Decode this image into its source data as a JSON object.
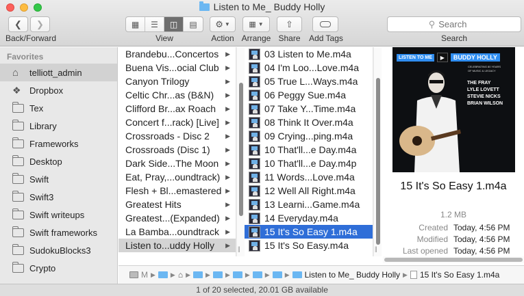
{
  "window": {
    "title": "Listen to Me_ Buddy Holly"
  },
  "toolbar": {
    "back_forward_label": "Back/Forward",
    "view_label": "View",
    "action_label": "Action",
    "arrange_label": "Arrange",
    "share_label": "Share",
    "add_tags_label": "Add Tags",
    "search_label": "Search",
    "search_placeholder": "Search",
    "active_view": "columns"
  },
  "sidebar": {
    "header": "Favorites",
    "items": [
      {
        "label": "telliott_admin",
        "icon": "home-icon",
        "selected": true
      },
      {
        "label": "Dropbox",
        "icon": "dropbox-icon"
      },
      {
        "label": "Tex",
        "icon": "folder-icon"
      },
      {
        "label": "Library",
        "icon": "folder-icon"
      },
      {
        "label": "Frameworks",
        "icon": "folder-icon"
      },
      {
        "label": "Desktop",
        "icon": "folder-icon"
      },
      {
        "label": "Swift",
        "icon": "folder-icon"
      },
      {
        "label": "Swift3",
        "icon": "folder-icon"
      },
      {
        "label": "Swift writeups",
        "icon": "folder-icon"
      },
      {
        "label": "Swift frameworks",
        "icon": "folder-icon"
      },
      {
        "label": "SudokuBlocks3",
        "icon": "folder-icon"
      },
      {
        "label": "Crypto",
        "icon": "folder-icon"
      }
    ]
  },
  "albums_column": {
    "items": [
      "Brandebu...Concertos",
      "Buena Vis...ocial Club",
      "Canyon Trilogy",
      "Celtic Chr...as (B&N)",
      "Clifford Br...ax Roach",
      "Concert f...rack) [Live]",
      "Crossroads - Disc 2",
      "Crossroads (Disc 1)",
      "Dark Side...The Moon",
      "Eat, Pray,...oundtrack)",
      "Flesh + Bl...emastered",
      "Greatest Hits",
      "Greatest...(Expanded)",
      "La Bamba...oundtrack",
      "Listen to...uddy Holly"
    ],
    "selected": "Listen to...uddy Holly"
  },
  "tracks_column": {
    "items": [
      "03 Listen to Me.m4a",
      "04 I'm Loo...Love.m4a",
      "05 True L...Ways.m4a",
      "06 Peggy Sue.m4a",
      "07 Take Y...Time.m4a",
      "08 Think It Over.m4a",
      "09 Crying...ping.m4a",
      "10 That'll...e Day.m4a",
      "10 That'll...e Day.m4p",
      "11 Words...Love.m4a",
      "12 Well All Right.m4a",
      "13 Learni...Game.m4a",
      "14 Everyday.m4a",
      "15 It's So Easy 1.m4a",
      "15 It's So Easy.m4a"
    ],
    "selected": "15 It's So Easy 1.m4a"
  },
  "preview": {
    "art": {
      "listen_to_me": "LISTEN TO ME",
      "artist": "BUDDY HOLLY",
      "subtitle_1": "CELEBRATING 80 YEARS",
      "subtitle_2": "OF MUSIC & LEGACY",
      "names": [
        "THE FRAY",
        "LYLE LOVETT",
        "STEVIE NICKS",
        "BRIAN WILSON"
      ]
    },
    "file_name": "15 It's So Easy 1.m4a",
    "size": "1.2 MB",
    "created_label": "Created",
    "created": "Today, 4:56 PM",
    "modified_label": "Modified",
    "modified": "Today, 4:56 PM",
    "last_opened_label": "Last opened",
    "last_opened": "Today, 4:56 PM"
  },
  "path_bar": {
    "first_crumb": "M",
    "folder_crumb": "Listen to Me_ Buddy Holly",
    "file_crumb": "15 It's So Easy 1.m4a"
  },
  "status_bar": {
    "text": "1 of 20 selected, 20.01 GB available"
  }
}
